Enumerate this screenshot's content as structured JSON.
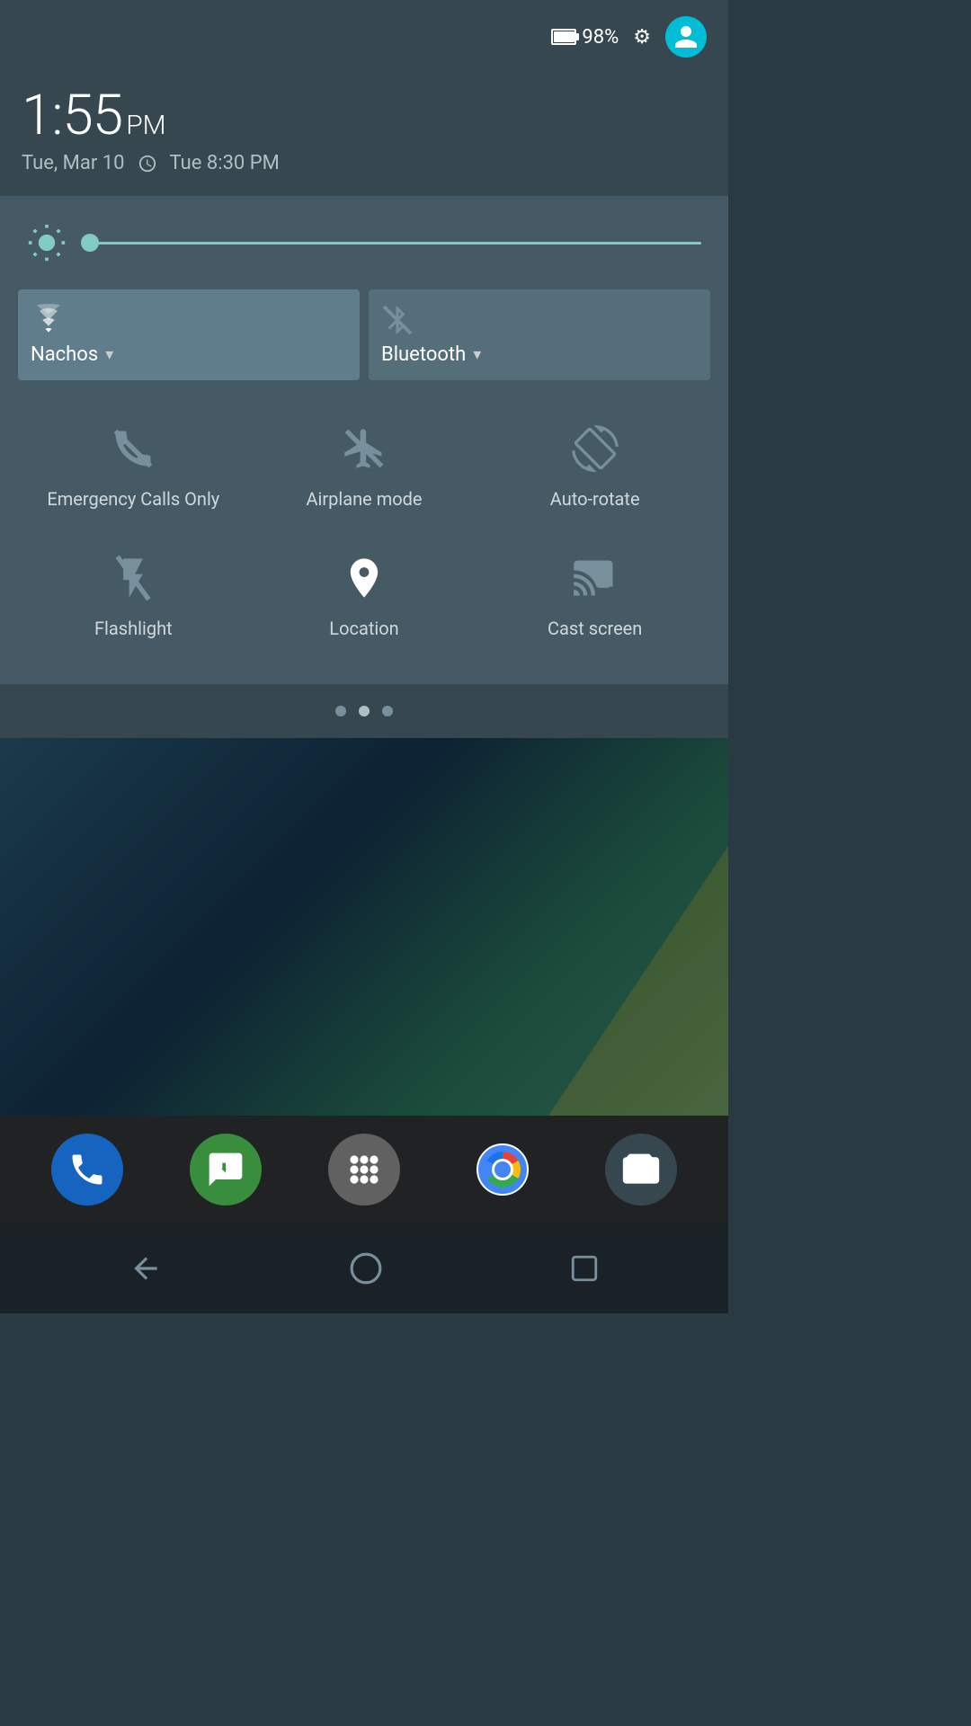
{
  "statusBar": {
    "battery_percent": "98%",
    "settings_icon": "⚙",
    "avatar_icon": "person"
  },
  "timeArea": {
    "time": "1:55",
    "ampm": "PM",
    "date": "Tue, Mar 10",
    "alarm_icon": "alarm",
    "alarm_time": "Tue 8:30 PM"
  },
  "brightness": {
    "label": "brightness"
  },
  "wifi": {
    "label": "Nachos",
    "dropdown": "▾"
  },
  "bluetooth": {
    "label": "Bluetooth",
    "dropdown": "▾"
  },
  "quickToggles": [
    {
      "id": "emergency-calls",
      "label": "Emergency Calls Only"
    },
    {
      "id": "airplane-mode",
      "label": "Airplane mode"
    },
    {
      "id": "auto-rotate",
      "label": "Auto-rotate"
    },
    {
      "id": "flashlight",
      "label": "Flashlight"
    },
    {
      "id": "location",
      "label": "Location"
    },
    {
      "id": "cast-screen",
      "label": "Cast screen"
    }
  ],
  "pageIndicator": {
    "dots": [
      false,
      true,
      false
    ]
  },
  "navBar": {
    "back": "◁",
    "home": "○",
    "recents": "□"
  }
}
